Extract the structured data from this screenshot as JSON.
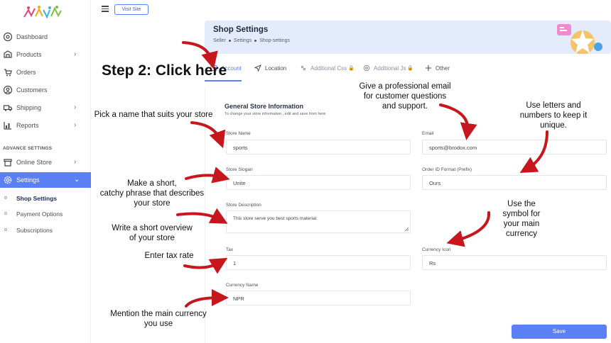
{
  "sidebar": {
    "items": [
      {
        "label": "Dashboard",
        "icon": "dashboard-icon",
        "chevron": false
      },
      {
        "label": "Products",
        "icon": "products-icon",
        "chevron": true
      },
      {
        "label": "Orders",
        "icon": "orders-icon",
        "chevron": false
      },
      {
        "label": "Customers",
        "icon": "customers-icon",
        "chevron": false
      },
      {
        "label": "Shipping",
        "icon": "shipping-icon",
        "chevron": true
      },
      {
        "label": "Reports",
        "icon": "reports-icon",
        "chevron": true
      }
    ],
    "section_label": "ADVANCE SETTINGS",
    "advance_items": [
      {
        "label": "Online Store",
        "icon": "store-icon",
        "chevron": true
      },
      {
        "label": "Settings",
        "icon": "settings-icon",
        "chevron": true,
        "active": true
      }
    ],
    "sub_items": [
      {
        "label": "Shop Settings",
        "active": true
      },
      {
        "label": "Payment Options",
        "active": false
      },
      {
        "label": "Subscriptions",
        "active": false
      }
    ],
    "chevron_right": "›",
    "chevron_down": "⌄"
  },
  "topbar": {
    "visit_site_label": "Visit Site"
  },
  "header": {
    "title": "Shop Settings",
    "breadcrumbs": [
      "Seller",
      "Settings",
      "Shop-settings"
    ]
  },
  "tabs": [
    {
      "label": "Account",
      "icon": "account-icon",
      "active": true
    },
    {
      "label": "Location",
      "icon": "location-icon",
      "active": false
    },
    {
      "label": "Additional Css",
      "icon": "css-icon",
      "locked": true
    },
    {
      "label": "Additional Js",
      "icon": "js-icon",
      "locked": true
    },
    {
      "label": "Other",
      "icon": "plus-icon",
      "active": false
    }
  ],
  "form": {
    "title": "General Store Information",
    "subtitle": "To change your store information , edit and save from here",
    "store_name": {
      "label": "Store Name",
      "value": "sports"
    },
    "email": {
      "label": "Email",
      "value": "sports@brodox.com"
    },
    "store_slogan": {
      "label": "Store Slogan",
      "value": "Unite"
    },
    "order_id_format": {
      "label": "Order ID Format (Prefix)",
      "value": "Ours"
    },
    "store_description": {
      "label": "Store Description",
      "value": "This store serve you best sports material."
    },
    "tax": {
      "label": "Tax",
      "value": "1"
    },
    "currency_icon": {
      "label": "Currency Icon",
      "value": "Rs"
    },
    "currency_name": {
      "label": "Currency Name",
      "value": "NPR"
    },
    "save_label": "Save"
  },
  "annotations": {
    "step": "Step 2: Click here",
    "email": [
      "Give a professional email",
      "for customer questions",
      "and support."
    ],
    "order_id": [
      "Use letters and",
      "numbers to keep it",
      "unique."
    ],
    "store_name": [
      "Pick a name that suits your store"
    ],
    "slogan": [
      "Make a short,",
      "catchy phrase that describes",
      "your store"
    ],
    "description": [
      "Write a short overview",
      "of your store"
    ],
    "tax": [
      "Enter tax rate"
    ],
    "currency_icon": [
      "Use the",
      "symbol for",
      "your main",
      "currency"
    ],
    "currency_name": [
      "Mention the main currency",
      "you use"
    ]
  },
  "colors": {
    "accent": "#5b7ff5",
    "header_bg": "#e4ecfb",
    "arrow": "#c8161d",
    "lock": "#e35c4f"
  }
}
